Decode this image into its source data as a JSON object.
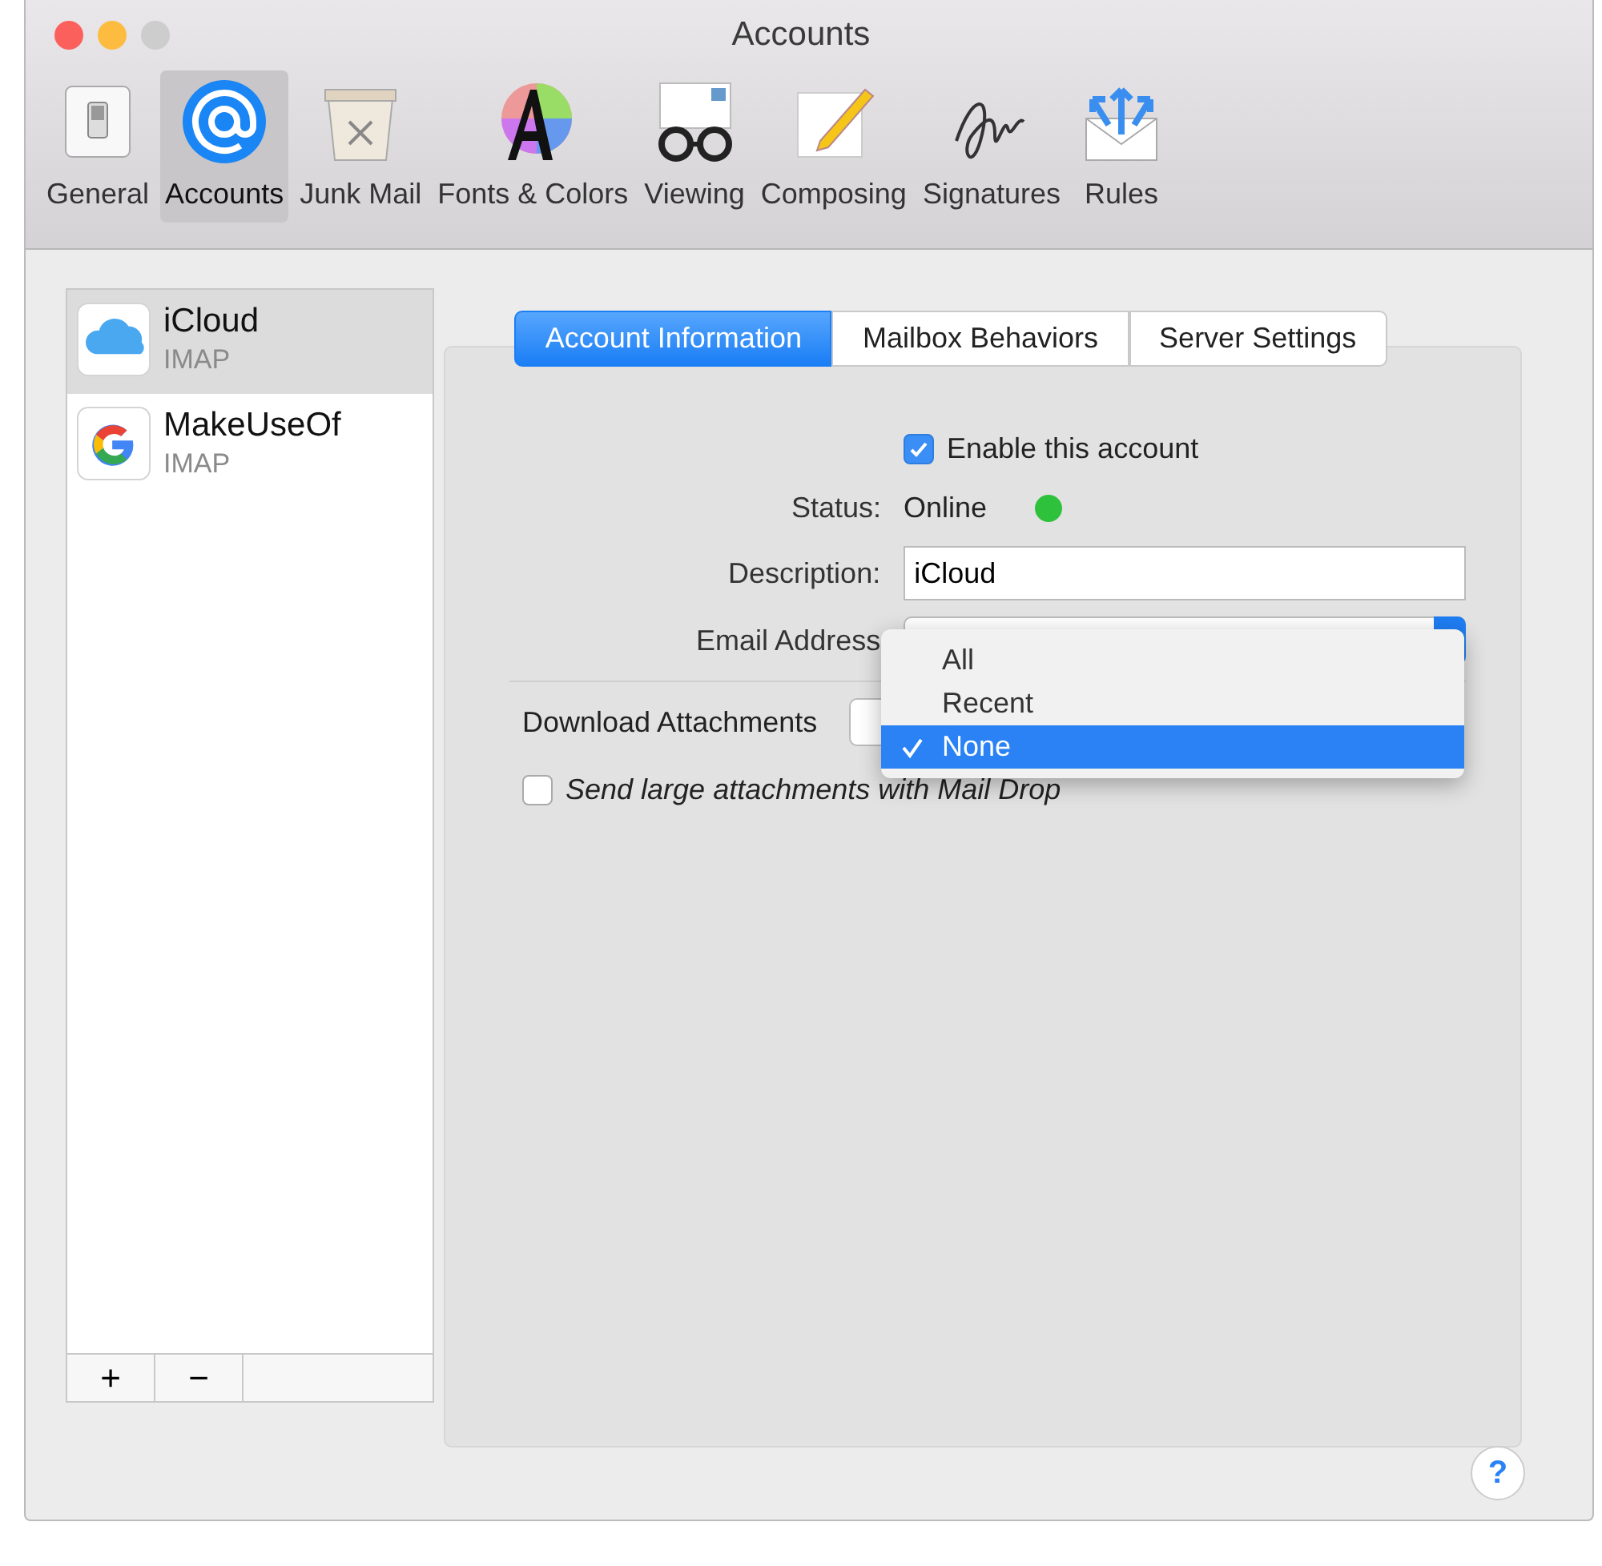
{
  "window": {
    "title": "Accounts"
  },
  "toolbar": [
    {
      "label": "General",
      "selected": false
    },
    {
      "label": "Accounts",
      "selected": true
    },
    {
      "label": "Junk Mail",
      "selected": false
    },
    {
      "label": "Fonts & Colors",
      "selected": false
    },
    {
      "label": "Viewing",
      "selected": false
    },
    {
      "label": "Composing",
      "selected": false
    },
    {
      "label": "Signatures",
      "selected": false
    },
    {
      "label": "Rules",
      "selected": false
    }
  ],
  "accounts": [
    {
      "name": "iCloud",
      "type": "IMAP",
      "selected": true
    },
    {
      "name": "MakeUseOf",
      "type": "IMAP",
      "selected": false
    }
  ],
  "list_buttons": [
    "+",
    "−"
  ],
  "tabs": [
    {
      "label": "Account Information",
      "selected": true
    },
    {
      "label": "Mailbox Behaviors",
      "selected": false
    },
    {
      "label": "Server Settings",
      "selected": false
    }
  ],
  "enable_account": {
    "label": "Enable this account",
    "checked": true
  },
  "status": {
    "label": "Status:",
    "value": "Online",
    "color": "#2ec13c"
  },
  "description": {
    "label": "Description:",
    "value": "iCloud"
  },
  "email_address": {
    "label": "Email Address"
  },
  "download_attachments": {
    "label": "Download Attachments"
  },
  "menu": [
    {
      "label": "All",
      "selected": false
    },
    {
      "label": "Recent",
      "selected": false
    },
    {
      "label": "None",
      "selected": true
    }
  ],
  "mail_drop": {
    "label": "Send large attachments with Mail Drop",
    "checked": false
  },
  "help": "?"
}
